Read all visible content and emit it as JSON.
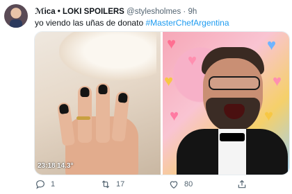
{
  "user": {
    "name": "ℳica • LOKI SPOILERS",
    "handle": "@stylesholmes",
    "separator": "·",
    "time": "9h"
  },
  "tweet": {
    "text": "yo viendo las uñas de donato ",
    "hashtag": "#MasterChefArgentina"
  },
  "media": {
    "left_overlay_time": "23:18",
    "left_overlay_temp": "14.3°"
  },
  "actions": {
    "replies": "1",
    "retweets": "17",
    "likes": "80"
  },
  "icons": [
    "reply-icon",
    "retweet-icon",
    "like-icon",
    "share-icon"
  ],
  "colors": {
    "accent": "#1d9bf0",
    "muted": "#536471",
    "text": "#0f1419"
  }
}
